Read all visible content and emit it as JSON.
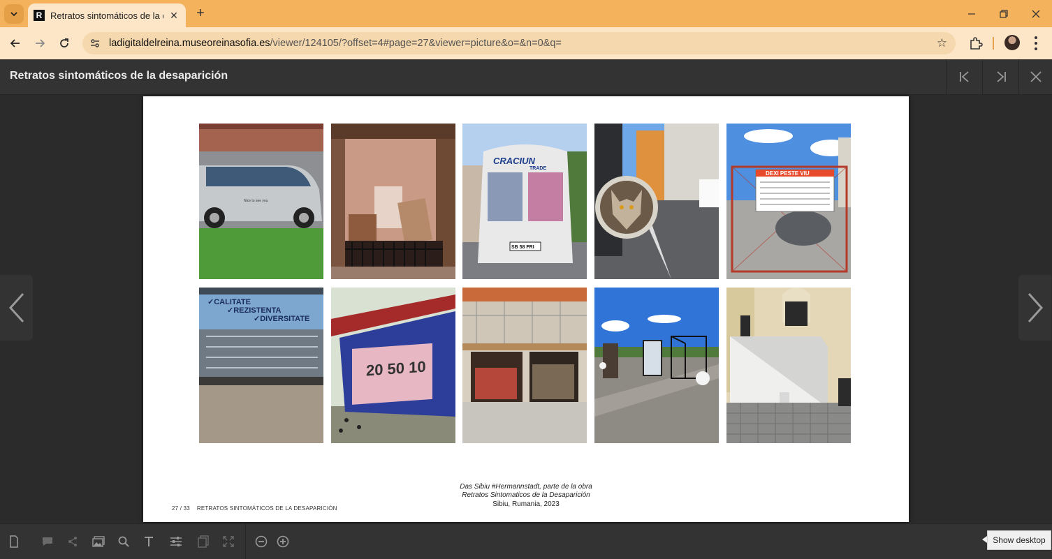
{
  "browser": {
    "tab_title": "Retratos sintomáticos de la desaparición",
    "favicon_letter": "R",
    "url_host": "ladigitaldelreina.museoreinasofia.es",
    "url_path": "/viewer/124105/?offset=4#page=27&viewer=picture&o=&n=0&q="
  },
  "viewer": {
    "title": "Retratos sintomáticos de la desaparición"
  },
  "page": {
    "caption_line1": "Das Sibiu #Hermannstadt, parte de la obra",
    "caption_line2": "Retratos Sintomaticos de la Desaparición",
    "caption_line3": "Sibiu, Rumania, 2023",
    "page_number": "27 / 33",
    "running_title": "RETRATOS SINTOMÁTICOS DE LA DESAPARICIÓN",
    "photos": [
      {
        "name": "photo-silver-van"
      },
      {
        "name": "photo-balcony-storage"
      },
      {
        "name": "photo-craciun-van"
      },
      {
        "name": "photo-wolf-tire-cover"
      },
      {
        "name": "photo-dexi-peste-viu-gate"
      },
      {
        "name": "photo-calitate-shop-window"
      },
      {
        "name": "photo-euro-notes-kiosk"
      },
      {
        "name": "photo-garage-stalls"
      },
      {
        "name": "photo-demolished-kiosk-frames"
      },
      {
        "name": "photo-white-wrapped-block"
      }
    ],
    "photo_texts": {
      "silver_van": "Nice to see you",
      "craciun": "CRACIUN",
      "craciun_sub": "TRADE",
      "plate": "SB 58 FRI",
      "dexi": "DEXI PESTE VIU",
      "calitate": "✓CALITATE",
      "rezistenta": "✓REZISTENTA",
      "diversitate": "✓DIVERSITATE",
      "notes": "20 50 10"
    }
  },
  "tooltip": {
    "label": "Show desktop"
  },
  "colors": {
    "tabbar": "#f4b25c",
    "toolbar": "#fde6c7",
    "viewer_bg": "#2b2b2b",
    "viewer_header": "#333333"
  }
}
